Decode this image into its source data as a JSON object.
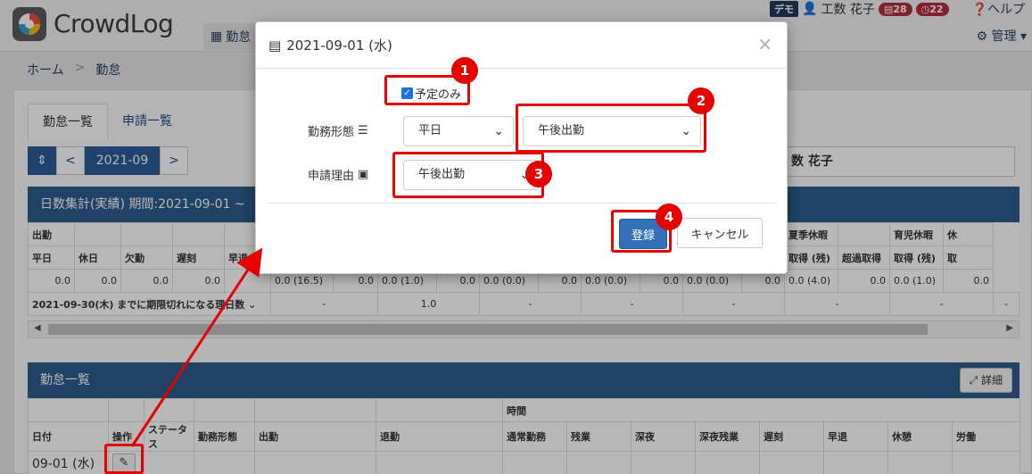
{
  "app": {
    "logo_text": "CrowdLog"
  },
  "topnav": {
    "kintai": "勤怠"
  },
  "user": {
    "demo": "デモ",
    "name": "工数 花子",
    "count1": "28",
    "count2": "22",
    "help": "ヘルプ",
    "admin": "管理"
  },
  "breadcrumb": {
    "home": "ホーム",
    "sep": ">",
    "current": "勤怠"
  },
  "tabs": [
    {
      "label": "勤怠一覧"
    },
    {
      "label": "申請一覧"
    }
  ],
  "month_nav": {
    "prev": "<",
    "month": "2021-09",
    "next": ">"
  },
  "employee": {
    "name": "数 花子"
  },
  "summary": {
    "title": "日数集計(実績)  期間:2021-09-01 ~",
    "groups": {
      "attendance": "出勤",
      "summer": "夏季休暇",
      "childcare": "育児休暇",
      "rest": "休"
    },
    "headers": [
      "平日",
      "休日",
      "欠勤",
      "遅刻",
      "早退",
      "取得 (残)",
      "超過取得",
      "取得 (残)",
      "超過取得",
      "取"
    ],
    "values": [
      "0.0",
      "0.0",
      "0.0",
      "0.0",
      "0.0 (16.5)",
      "0.0",
      "0.0 (1.0)",
      "0.0",
      "0.0 (0.0)",
      "0.0",
      "0.0 (0.0)",
      "0.0",
      "0.0 (0.0)",
      "0.0",
      "0.0 (4.0)",
      "0.0",
      "0.0 (1.0)",
      "0.0",
      "0.0"
    ],
    "expire_label": "2021-09-30(木) までに期限切れになる理日数",
    "expire_values": [
      "-",
      "1.0",
      "-",
      "-",
      "-",
      "-",
      "-",
      "-"
    ]
  },
  "list": {
    "title": "勤怠一覧",
    "detail_button": "詳細",
    "time_group": "時間",
    "headers": [
      "日付",
      "操作",
      "ステータス",
      "勤務形態",
      "出勤",
      "退勤",
      "通常勤務",
      "残業",
      "深夜",
      "深夜残業",
      "遅刻",
      "早退",
      "休憩",
      "労働"
    ],
    "rows": [
      {
        "date": "09-01 (水)"
      }
    ]
  },
  "modal": {
    "title": "2021-09-01 (水)",
    "close": "×",
    "scheduled_only": "予定のみ",
    "work_type_label": "勤務形態",
    "work_type_value": "平日",
    "work_subtype_value": "午後出勤",
    "reason_label": "申請理由",
    "reason_value": "午後出勤",
    "register": "登録",
    "cancel": "キャンセル"
  },
  "callouts": [
    "1",
    "2",
    "3",
    "4"
  ],
  "colors": {
    "accent": "#2b5c8c",
    "callout": "#e60000",
    "primary_button": "#3271b8"
  }
}
